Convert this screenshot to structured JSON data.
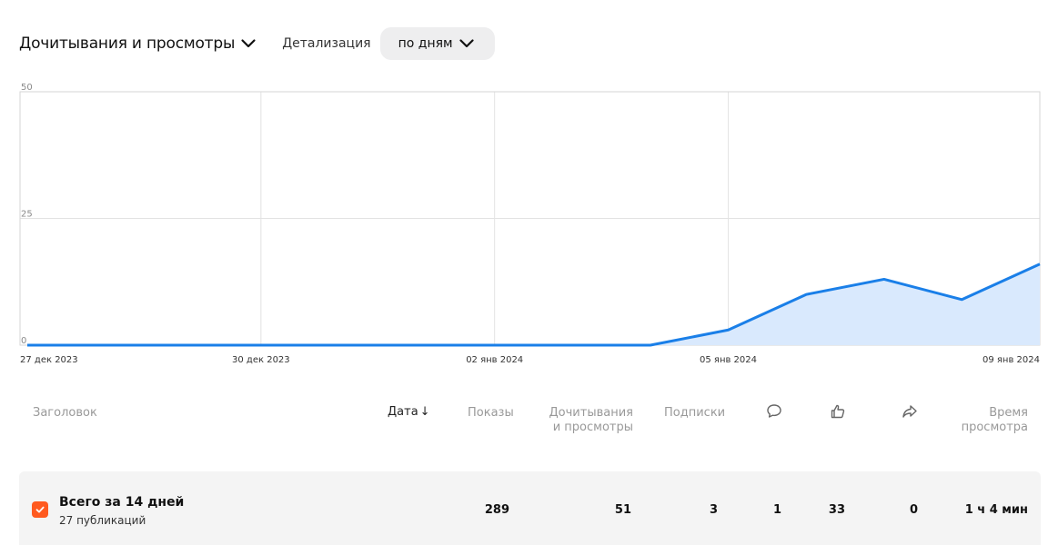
{
  "header": {
    "metric_select": "Дочитывания и просмотры",
    "detail_label": "Детализация",
    "detail_select": "по дням"
  },
  "colors": {
    "line": "#1a7fe8",
    "area": "#d9e9fd",
    "accent_checkbox": "#ff5a1f",
    "row_bg": "#f4f4f4"
  },
  "chart_data": {
    "type": "area",
    "x": [
      "27 дек 2023",
      "28 дек 2023",
      "29 дек 2023",
      "30 дек 2023",
      "31 дек 2023",
      "01 янв 2024",
      "02 янв 2024",
      "03 янв 2024",
      "04 янв 2024",
      "05 янв 2024",
      "06 янв 2024",
      "07 янв 2024",
      "08 янв 2024",
      "09 янв 2024"
    ],
    "series": [
      {
        "values": [
          0,
          0,
          0,
          0,
          0,
          0,
          0,
          0,
          0,
          3,
          10,
          13,
          9,
          16
        ]
      }
    ],
    "xticks": [
      "27 дек 2023",
      "30 дек 2023",
      "02 янв 2024",
      "05 янв 2024",
      "09 янв 2024"
    ],
    "yticks": [
      "50",
      "25",
      "0"
    ],
    "ylim": [
      0,
      50
    ],
    "grid": true
  },
  "table": {
    "headers": {
      "title": "Заголовок",
      "date": "Дата",
      "date_sort": "↓",
      "views": "Показы",
      "reads_line1": "Дочитывания",
      "reads_line2": "и просмотры",
      "subs": "Подписки",
      "comments_icon": "comment-icon",
      "likes_icon": "thumbs-up-icon",
      "shares_icon": "share-icon",
      "time_line1": "Время",
      "time_line2": "просмотра"
    },
    "total": {
      "title": "Всего за 14 дней",
      "subtitle": "27 публикаций",
      "views": "289",
      "reads": "51",
      "subs": "3",
      "comments": "1",
      "likes": "33",
      "shares": "0",
      "time": "1 ч 4 мин"
    }
  }
}
